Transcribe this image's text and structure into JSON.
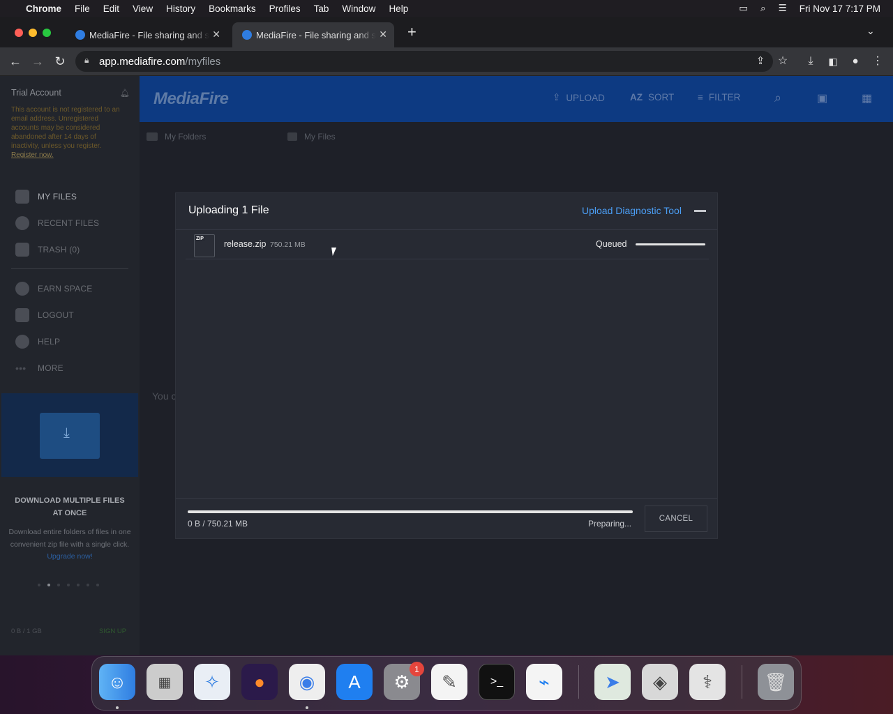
{
  "menubar": {
    "app": "Chrome",
    "items": [
      "File",
      "Edit",
      "View",
      "History",
      "Bookmarks",
      "Profiles",
      "Tab",
      "Window",
      "Help"
    ],
    "datetime": "Fri Nov 17  7:17 PM"
  },
  "tabs": [
    {
      "title": "MediaFire - File sharing and st"
    },
    {
      "title": "MediaFire - File sharing and st"
    }
  ],
  "address": {
    "host": "app.mediafire.com",
    "path": "/myfiles"
  },
  "sidebar": {
    "trial": "Trial Account",
    "warning": "This account is not registered to an email address. Unregistered accounts may be considered abandoned after 14 days of inactivity, unless you register.",
    "register_link": "Register now.",
    "nav": [
      "MY FILES",
      "RECENT FILES",
      "TRASH (0)",
      "EARN SPACE",
      "LOGOUT",
      "HELP",
      "MORE"
    ],
    "promo_title": "DOWNLOAD MULTIPLE FILES AT ONCE",
    "promo_text": "Download entire folders of files in one convenient zip file with a single click.",
    "promo_link": "Upgrade now!",
    "storage": "0 B / 1 GB",
    "signup": "SIGN UP"
  },
  "header": {
    "logo": "MediaFire",
    "upload": "UPLOAD",
    "sort": "SORT",
    "filter": "FILTER"
  },
  "breadcrumbs": {
    "folders": "My Folders",
    "files": "My Files"
  },
  "background_text": "You c",
  "dialog": {
    "title": "Uploading 1 File",
    "diagnostic": "Upload Diagnostic Tool",
    "file": {
      "icon_label": "ZIP",
      "name": "release.zip",
      "size": "750.21 MB",
      "status": "Queued"
    },
    "total": "0 B / 750.21 MB",
    "progress": 0,
    "state": "Preparing...",
    "cancel": "CANCEL"
  },
  "dock": {
    "settings_badge": "1"
  }
}
